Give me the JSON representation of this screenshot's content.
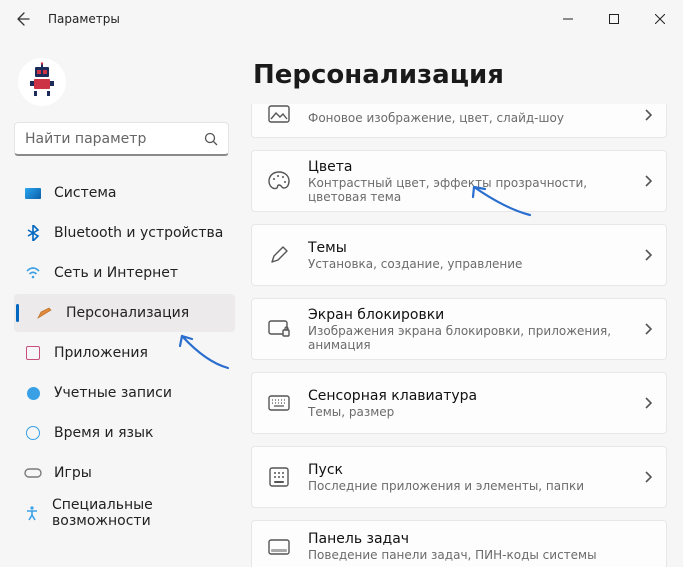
{
  "window": {
    "app_title": "Параметры"
  },
  "search": {
    "placeholder": "Найти параметр"
  },
  "nav": {
    "system": "Система",
    "bluetooth": "Bluetooth и устройства",
    "network": "Сеть и Интернет",
    "personalization": "Персонализация",
    "apps": "Приложения",
    "accounts": "Учетные записи",
    "time": "Время и язык",
    "gaming": "Игры",
    "accessibility": "Специальные возможности"
  },
  "page": {
    "title": "Персонализация"
  },
  "cards": {
    "background": {
      "sub": "Фоновое изображение, цвет, слайд-шоу"
    },
    "colors": {
      "title": "Цвета",
      "sub": "Контрастный цвет, эффекты прозрачности, цветовая тема"
    },
    "themes": {
      "title": "Темы",
      "sub": "Установка, создание, управление"
    },
    "lockscreen": {
      "title": "Экран блокировки",
      "sub": "Изображения экрана блокировки, приложения, анимация"
    },
    "touchkb": {
      "title": "Сенсорная клавиатура",
      "sub": "Темы, размер"
    },
    "start": {
      "title": "Пуск",
      "sub": "Последние приложения и элементы, папки"
    },
    "taskbar": {
      "title": "Панель задач",
      "sub": "Поведение панели задач, ПИН-коды системы"
    }
  }
}
